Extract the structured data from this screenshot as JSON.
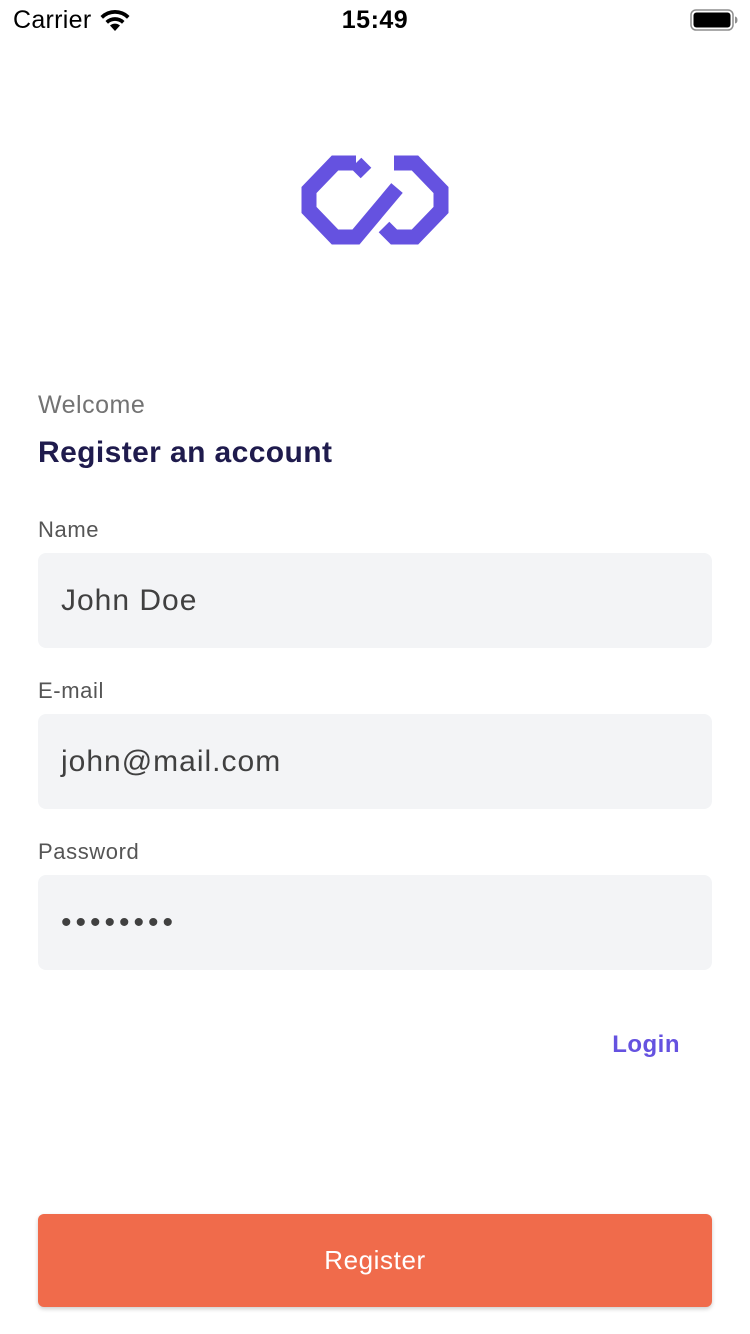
{
  "status_bar": {
    "carrier": "Carrier",
    "time": "15:49",
    "icons": [
      "wifi-icon",
      "battery-icon"
    ]
  },
  "logo": {
    "icon": "infinity-logo-icon",
    "color": "#6552e0"
  },
  "header": {
    "welcome": "Welcome",
    "title": "Register an account"
  },
  "form": {
    "name": {
      "label": "Name",
      "value": "John Doe"
    },
    "email": {
      "label": "E-mail",
      "value": "john@mail.com"
    },
    "password": {
      "label": "Password",
      "value": "••••••••"
    }
  },
  "links": {
    "login": "Login"
  },
  "actions": {
    "register": "Register"
  },
  "colors": {
    "accent": "#6552e0",
    "title": "#1f1b4d",
    "button": "#f06b4b",
    "field_bg": "#f3f4f6"
  }
}
